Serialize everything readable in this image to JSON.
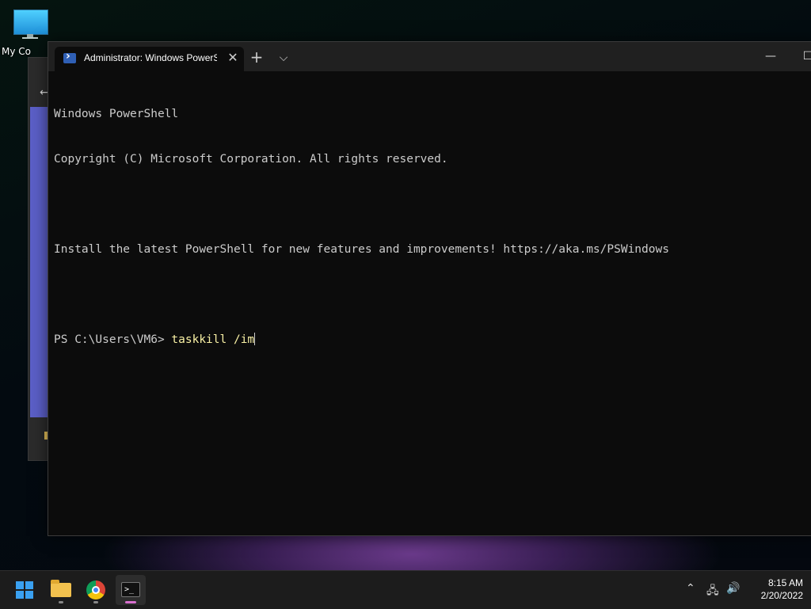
{
  "desktop": {
    "icons": [
      {
        "label": "My Co",
        "icon": "computer-icon"
      }
    ]
  },
  "terminal": {
    "tab_title": "Administrator: Windows PowerS",
    "tab_icon": "powershell-icon",
    "lines": [
      "Windows PowerShell",
      "Copyright (C) Microsoft Corporation. All rights reserved.",
      "",
      "Install the latest PowerShell for new features and improvements! https://aka.ms/PSWindows",
      ""
    ],
    "prompt": "PS C:\\Users\\VM6> ",
    "command": "taskkill /im",
    "colors": {
      "background": "#0c0c0c",
      "text": "#cccccc",
      "command": "#f9f1a5"
    }
  },
  "taskbar": {
    "apps": [
      "windows-start-icon",
      "file-explorer-icon",
      "chrome-icon",
      "terminal-icon"
    ],
    "time": "8:15 AM",
    "date": "2/20/2022"
  }
}
